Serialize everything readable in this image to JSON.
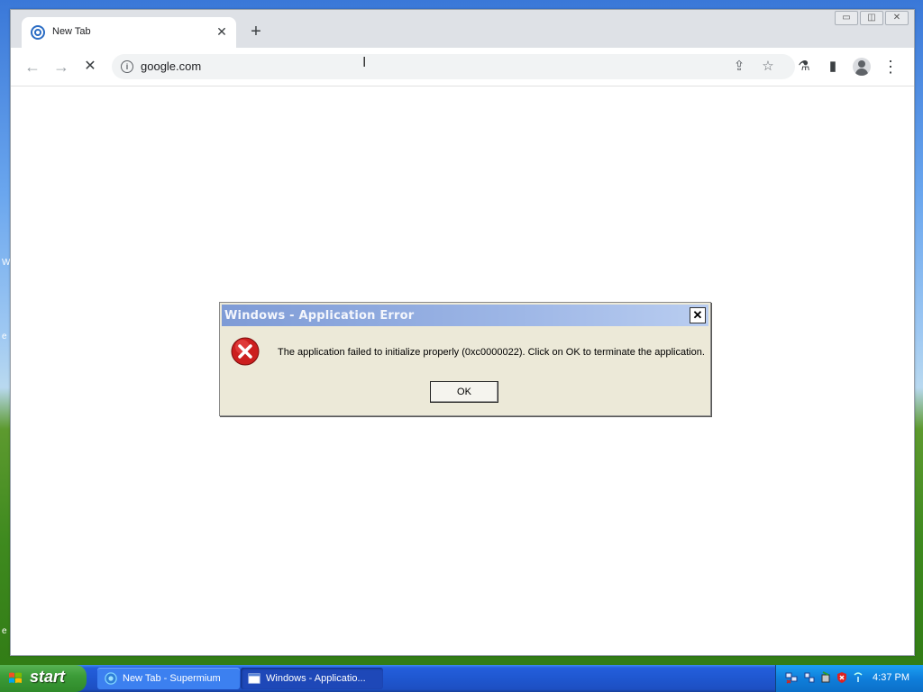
{
  "desktop": {
    "edge_chars": [
      "W",
      "e",
      "e"
    ]
  },
  "browser": {
    "tab": {
      "title": "New Tab",
      "close_glyph": "✕"
    },
    "new_tab_glyph": "+",
    "window_controls": {
      "minimize": "▭",
      "restore": "◫",
      "close": "✕"
    },
    "nav": {
      "back": "←",
      "forward": "→",
      "stop": "✕"
    },
    "omnibox": {
      "info_glyph": "i",
      "url": "google.com"
    },
    "icons": {
      "share": "⇪",
      "bookmark": "☆",
      "labs": "⚗",
      "side_panel": "▮",
      "menu": "⋮"
    },
    "text_cursor": "I"
  },
  "dialog": {
    "title": "Windows - Application Error",
    "close_glyph": "✕",
    "message": "The application failed to initialize properly (0xc0000022). Click on OK to terminate the application.",
    "ok_label": "OK"
  },
  "taskbar": {
    "start_label": "start",
    "tasks": [
      {
        "label": "New Tab - Supermium"
      },
      {
        "label": "Windows - Applicatio..."
      }
    ],
    "clock": "4:37 PM"
  },
  "colors": {
    "taskbar_blue": "#245edb",
    "start_green": "#3c9c38",
    "dialog_bg": "#ece9d8",
    "error_red": "#cc1f1f"
  }
}
